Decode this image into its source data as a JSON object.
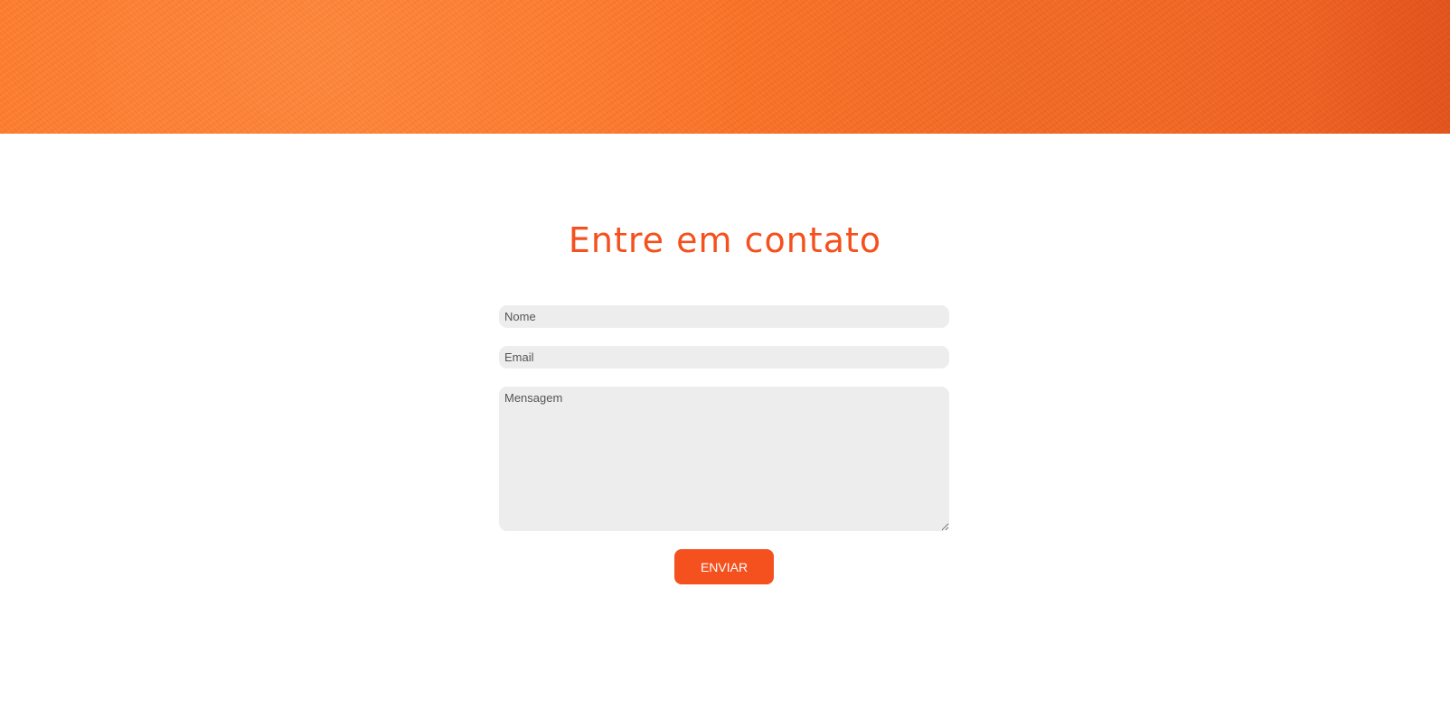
{
  "colors": {
    "accent": "#f4511e",
    "banner": "#ff7a2a",
    "field_background": "#ededed"
  },
  "contact": {
    "title": "Entre em contato",
    "form": {
      "name_placeholder": "Nome",
      "email_placeholder": "Email",
      "message_placeholder": "Mensagem",
      "submit_label": "ENVIAR"
    }
  }
}
